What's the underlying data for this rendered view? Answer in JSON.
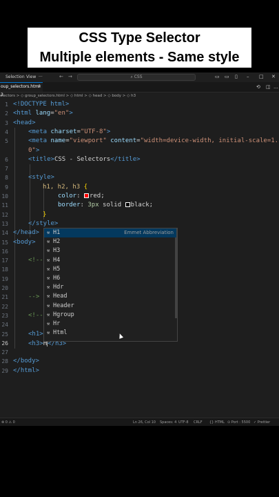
{
  "caption": {
    "line1": "CSS Type Selector",
    "line2": "Multiple elements - Same style"
  },
  "titlebar": {
    "menu_selection": "Selection",
    "menu_view": "View",
    "menu_more": "···",
    "nav_back": "←",
    "nav_forward": "→",
    "search": "CSS"
  },
  "tab": {
    "label": "oup_selectors.html 3",
    "close": "✕"
  },
  "breadcrumb": "electors > ◇ group_selectors.html > ◇ html > ◇ head > ◇ body > ◇ h3",
  "code_lines": [
    {
      "n": "1",
      "text": "<!DOCTYPE html>"
    },
    {
      "n": "2",
      "text": "<html lang=\"en\">"
    },
    {
      "n": "3",
      "text": "<head>"
    },
    {
      "n": "4",
      "text": "<meta charset=\"UTF-8\">"
    },
    {
      "n": "5",
      "text": "<meta name=\"viewport\" content=\"width=device-width, initial-scale=1."
    },
    {
      "n": "",
      "text": "0\">"
    },
    {
      "n": "6",
      "text": "<title>CSS - Selectors</title>"
    },
    {
      "n": "7",
      "text": ""
    },
    {
      "n": "8",
      "text": "<style>"
    },
    {
      "n": "9",
      "text": "h1, h2, h3 {"
    },
    {
      "n": "10",
      "text": "color: red;"
    },
    {
      "n": "11",
      "text": "border: 3px solid black;"
    },
    {
      "n": "12",
      "text": "}"
    },
    {
      "n": "13",
      "text": "</style>"
    },
    {
      "n": "14",
      "text": "</head>"
    },
    {
      "n": "15",
      "text": "<body>"
    },
    {
      "n": "16",
      "text": ""
    },
    {
      "n": "17",
      "text": "<!--"
    },
    {
      "n": "18",
      "text": ""
    },
    {
      "n": "19",
      "text": ""
    },
    {
      "n": "20",
      "text": ""
    },
    {
      "n": "21",
      "text": ""
    },
    {
      "n": "22",
      "text": "-->"
    },
    {
      "n": "23",
      "text": ""
    },
    {
      "n": "24",
      "text": "<!--"
    },
    {
      "n": "25",
      "text": "<h1>H"
    },
    {
      "n": "26",
      "text": "<h3>H</h3>"
    },
    {
      "n": "27",
      "text": ""
    },
    {
      "n": "28",
      "text": "</body>"
    },
    {
      "n": "29",
      "text": "</html>"
    }
  ],
  "suggestions": [
    {
      "label": "H1",
      "detail": "Emmet Abbreviation",
      "focused": true
    },
    {
      "label": "H2"
    },
    {
      "label": "H3"
    },
    {
      "label": "H4"
    },
    {
      "label": "H5"
    },
    {
      "label": "H6"
    },
    {
      "label": "Hdr"
    },
    {
      "label": "Head"
    },
    {
      "label": "Header"
    },
    {
      "label": "Hgroup"
    },
    {
      "label": "Hr"
    },
    {
      "label": "Html"
    }
  ],
  "statusbar": {
    "left": "⊗ 0 ⚠ 0",
    "position": "Ln 26, Col 10",
    "spaces": "Spaces: 4",
    "encoding": "UTF-8",
    "eol": "CRLF",
    "language": "{} HTML",
    "port": "⊙ Port : 5500",
    "prettier": "✓ Prettier"
  },
  "colors": {
    "tag": "#569cd6",
    "attr": "#9cdcfe",
    "string": "#ce9178",
    "selector": "#d7ba7d",
    "suggest_focus": "#04395e"
  }
}
